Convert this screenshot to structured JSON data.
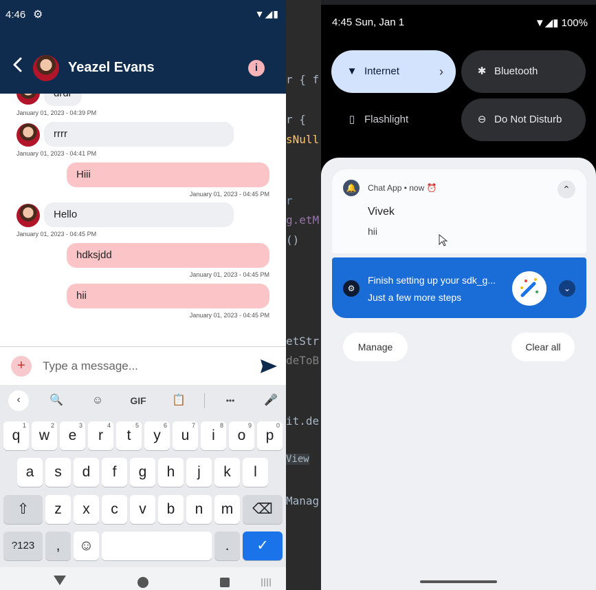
{
  "left_phone": {
    "status": {
      "time": "4:46",
      "icons": "▼◢▮"
    },
    "header": {
      "contact_name": "Yeazel Evans",
      "info_icon": "i"
    },
    "messages": [
      {
        "dir": "in",
        "text": "drdr",
        "timestamp": "January 01, 2023 - 04:39 PM"
      },
      {
        "dir": "in",
        "text": "rrrr",
        "timestamp": "January 01, 2023 - 04:41 PM"
      },
      {
        "dir": "out",
        "text": "Hiii",
        "timestamp": "January 01, 2023 - 04:45 PM"
      },
      {
        "dir": "in",
        "text": "Hello",
        "timestamp": "January 01, 2023 - 04:45 PM"
      },
      {
        "dir": "out",
        "text": "hdksjdd",
        "timestamp": "January 01, 2023 - 04:45 PM"
      },
      {
        "dir": "out",
        "text": "hii",
        "timestamp": "January 01, 2023 - 04:45 PM"
      }
    ],
    "input": {
      "placeholder": "Type a message...",
      "value": "",
      "attach_label": "+"
    },
    "keyboard": {
      "toolbar": {
        "back": "‹",
        "search": "🔍",
        "sticker": "☺",
        "gif": "GIF",
        "clipboard": "📋",
        "more": "•••",
        "mic": "🎤"
      },
      "row1": [
        [
          "q",
          "1"
        ],
        [
          "w",
          "2"
        ],
        [
          "e",
          "3"
        ],
        [
          "r",
          "4"
        ],
        [
          "t",
          "5"
        ],
        [
          "y",
          "6"
        ],
        [
          "u",
          "7"
        ],
        [
          "i",
          "8"
        ],
        [
          "o",
          "9"
        ],
        [
          "p",
          "0"
        ]
      ],
      "row2": [
        "a",
        "s",
        "d",
        "f",
        "g",
        "h",
        "j",
        "k",
        "l"
      ],
      "row3": [
        "z",
        "x",
        "c",
        "v",
        "b",
        "n",
        "m"
      ],
      "shift": "⇧",
      "backspace": "⌫",
      "symbols": "?123",
      "comma": ",",
      "emoji": "☺",
      "period": ".",
      "enter": "✓"
    }
  },
  "code_strip": {
    "lines": [
      {
        "text": "r { f",
        "color": "#a9b7c6"
      },
      {
        "text": "r {",
        "color": "#a9b7c6"
      },
      {
        "text": "sNull",
        "color": "#ffc66d"
      },
      {
        "text": "r",
        "color": "#6897bb"
      },
      {
        "text": "g.etM",
        "color": "#9876aa"
      },
      {
        "text": "()",
        "color": "#a9b7c6"
      },
      {
        "text": "etStr",
        "color": "#a9b7c6"
      },
      {
        "text": "deToB",
        "color": "#808080"
      },
      {
        "text": "it.de",
        "color": "#a9b7c6"
      },
      {
        "text": "View",
        "color": "#a9b7c6"
      },
      {
        "text": "Manag",
        "color": "#a9b7c6"
      }
    ]
  },
  "right_phone": {
    "status": {
      "datetime": "4:45 Sun, Jan 1",
      "battery": "100%",
      "icons": "▼◢▮"
    },
    "quick_tiles": [
      {
        "label": "Internet",
        "icon": "▼",
        "state": "on"
      },
      {
        "label": "Bluetooth",
        "icon": "✱",
        "state": "off"
      },
      {
        "label": "Flashlight",
        "icon": "▯",
        "state": "off"
      },
      {
        "label": "Do Not Disturb",
        "icon": "⊖",
        "state": "off"
      }
    ],
    "notifications": [
      {
        "app": "Chat App • now",
        "title": "Vivek",
        "text": "hii",
        "icon": "🔔"
      },
      {
        "title": "Finish setting up your sdk_g...",
        "text": "Just a few more steps",
        "icon": "⚙"
      }
    ],
    "actions": {
      "manage": "Manage",
      "clear_all": "Clear all"
    }
  },
  "colors": {
    "header_bg": "#0f2b4d",
    "outgoing_bubble": "#fbc5c8",
    "incoming_bubble": "#eeeff2",
    "accent_blue": "#1a73e8",
    "tile_on": "#d3e3fd"
  }
}
